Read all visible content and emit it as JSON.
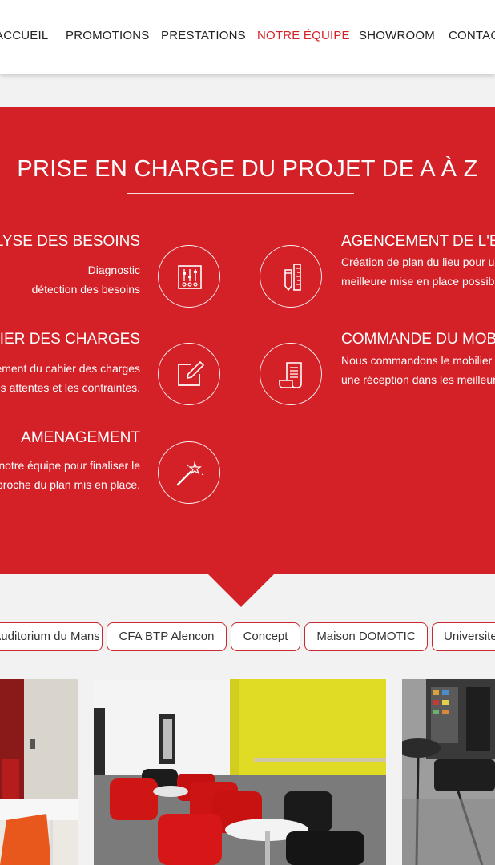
{
  "nav": {
    "items": [
      {
        "label": "ACCUEIL",
        "active": false
      },
      {
        "label": "PROMOTIONS",
        "active": false
      },
      {
        "label": "PRESTATIONS",
        "active": false
      },
      {
        "label": "NOTRE ÉQUIPE",
        "active": true
      },
      {
        "label": "SHOWROOM",
        "active": false
      },
      {
        "label": "CONTACT",
        "active": false
      }
    ]
  },
  "process": {
    "title": "PRISE EN CHARGE DU PROJET DE A À Z",
    "steps": [
      {
        "title": "ANALYSE DES BESOINS",
        "lines": [
          "Diagnostic",
          "détection des besoins"
        ],
        "icon": "sliders-icon"
      },
      {
        "title": "AGENCEMENT DE L'ESPACE",
        "lines": [
          "Création de plan du lieu pour une",
          "meilleure mise en place possible."
        ],
        "icon": "pencil-ruler-icon"
      },
      {
        "title": "CAHIER DES CHARGES",
        "lines": [
          "Établissement du cahier des charges",
          "selon vos attentes et les contraintes."
        ],
        "icon": "edit-icon"
      },
      {
        "title": "COMMANDE DU MOBILIER",
        "lines": [
          "Nous commandons le mobilier pour",
          "une réception dans les meilleurs délais."
        ],
        "icon": "scroll-icon"
      },
      {
        "title": "AMENAGEMENT",
        "lines": [
          "Intervention de notre équipe pour finaliser le",
          "projet au plus proche du plan mis en place."
        ],
        "icon": "magic-wand-icon"
      }
    ]
  },
  "filters": [
    "Auditorium du Mans",
    "CFA BTP Alencon",
    "Concept",
    "Maison DOMOTIC",
    "Universite"
  ],
  "colors": {
    "brand_red": "#d42027",
    "active_nav": "#d71f26",
    "tab_border": "#c8292f"
  }
}
